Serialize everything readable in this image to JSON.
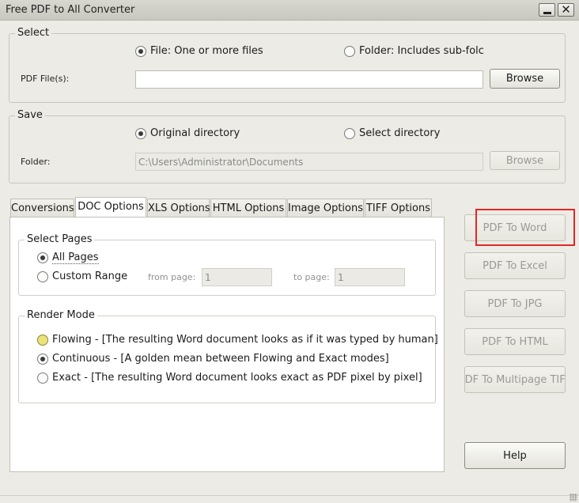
{
  "window": {
    "title": "Free PDF to All Converter",
    "minimize_glyph": "",
    "close_glyph": "✕"
  },
  "select": {
    "title": "Select",
    "file_option": "File:  One or more files",
    "folder_option": "Folder: Includes sub-folc",
    "pdf_files_label": "PDF File(s):",
    "pdf_files_value": "",
    "browse_label": "Browse"
  },
  "save": {
    "title": "Save",
    "original_option": "Original directory",
    "select_option": "Select directory",
    "folder_label": "Folder:",
    "folder_value": "C:\\Users\\Administrator\\Documents",
    "browse_label": "Browse"
  },
  "tabs": [
    {
      "label": "Conversions",
      "active": false
    },
    {
      "label": "DOC Options",
      "active": true
    },
    {
      "label": "XLS Options",
      "active": false
    },
    {
      "label": "HTML Options",
      "active": false
    },
    {
      "label": "Image Options",
      "active": false
    },
    {
      "label": "TIFF Options",
      "active": false
    }
  ],
  "doc_options": {
    "select_pages": {
      "title": "Select Pages",
      "all_pages": "All Pages",
      "custom_range": "Custom Range",
      "from_label": "from page:",
      "from_value": "1",
      "to_label": "to page:",
      "to_value": "1"
    },
    "render_mode": {
      "title": "Render Mode",
      "flowing": "Flowing - [The resulting Word document looks as if it was typed by human]",
      "continuous": "Continuous - [A golden mean between Flowing and Exact modes]",
      "exact": "Exact - [The resulting Word document looks exact as PDF pixel by pixel]"
    }
  },
  "actions": {
    "pdf_to_word": "PDF To Word",
    "pdf_to_excel": "PDF To Excel",
    "pdf_to_jpg": "PDF To JPG",
    "pdf_to_html": "PDF To HTML",
    "pdf_to_multipage_tiff": "PDF To Multipage TIFF",
    "help": "Help"
  },
  "colors": {
    "highlight": "#e02828",
    "window_bg": "#ecebe5",
    "disabled_text": "#9a9a94"
  }
}
